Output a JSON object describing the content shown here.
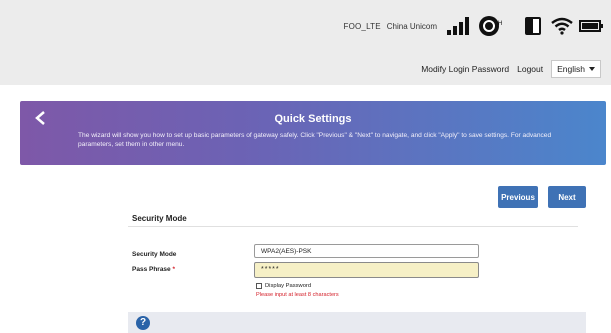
{
  "status_bar": {
    "network_name": "FOO_LTE",
    "carrier": "China Unicom",
    "signal_level": 4,
    "network_type": "H",
    "icons": [
      "signal-icon",
      "globe-icon",
      "sim-icon",
      "wifi-icon",
      "battery-icon"
    ]
  },
  "header_links": {
    "modify_password": "Modify Login Password",
    "logout": "Logout",
    "language": "English"
  },
  "banner": {
    "title": "Quick Settings",
    "description": "The wizard will show you how to set up basic parameters of gateway safely. Click \"Previous\" & \"Next\" to navigate, and click \"Apply\" to save settings. For advanced parameters, set them in other menu.",
    "back_icon": "chevron-left-icon",
    "gradient_colors": [
      "#7e58a8",
      "#4b86cc"
    ]
  },
  "nav_buttons": {
    "previous": "Previous",
    "next": "Next",
    "color": "#3f72b5"
  },
  "security_section": {
    "title": "Security Mode",
    "mode_label": "Security Mode",
    "mode_value": "WPA2(AES)-PSK",
    "pass_label": "Pass Phrase",
    "pass_required_mark": "*",
    "pass_value": "*****",
    "display_password_label": "Display Password",
    "display_password_checked": false,
    "error_text": "Please input at least 8 characters"
  },
  "help": {
    "icon": "help-icon",
    "symbol": "?"
  }
}
